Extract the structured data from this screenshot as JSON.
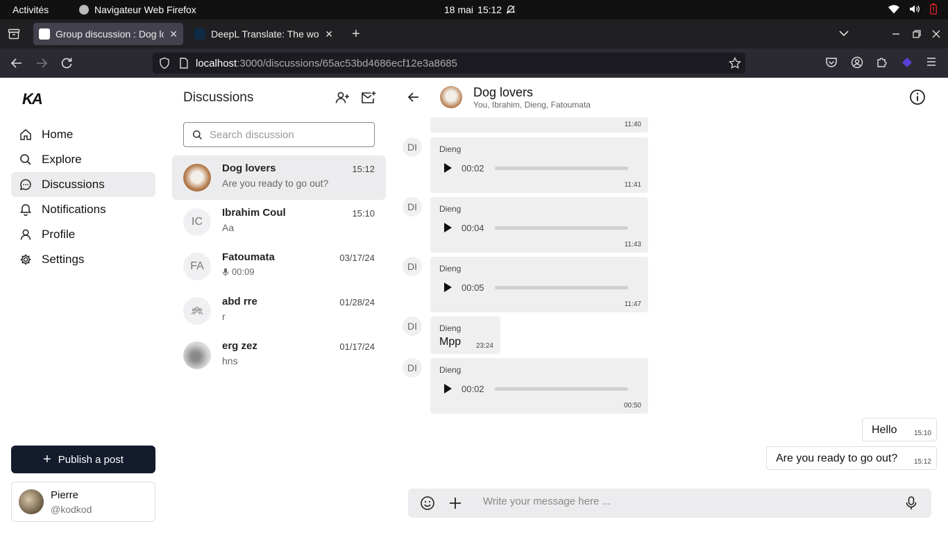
{
  "system_bar": {
    "activities": "Activités",
    "app_name": "Navigateur Web Firefox",
    "date": "18 mai",
    "time": "15:12"
  },
  "browser": {
    "tabs": [
      {
        "title": "Group discussion : Dog lo",
        "active": true
      },
      {
        "title": "DeepL Translate: The wo",
        "active": false
      }
    ],
    "url_host": "localhost",
    "url_path": ":3000/discussions/65ac53bd4686ecf12e3a8685"
  },
  "sidebar": {
    "logo": "KA",
    "items": [
      {
        "label": "Home",
        "icon": "home-icon"
      },
      {
        "label": "Explore",
        "icon": "search-icon"
      },
      {
        "label": "Discussions",
        "icon": "chat-icon",
        "active": true
      },
      {
        "label": "Notifications",
        "icon": "bell-icon"
      },
      {
        "label": "Profile",
        "icon": "user-icon"
      },
      {
        "label": "Settings",
        "icon": "gear-icon"
      }
    ],
    "publish_label": "Publish a post",
    "user": {
      "name": "Pierre",
      "handle": "@kodkod"
    }
  },
  "discussions": {
    "title": "Discussions",
    "search_placeholder": "Search discussion",
    "items": [
      {
        "name": "Dog lovers",
        "preview": "Are you ready to go out?",
        "time": "15:12",
        "avatar": "",
        "active": true
      },
      {
        "name": "Ibrahim Coul",
        "preview": "Aa",
        "time": "15:10",
        "avatar": "IC"
      },
      {
        "name": "Fatoumata",
        "preview": "00:09",
        "time": "03/17/24",
        "avatar": "FA"
      },
      {
        "name": "abd rre",
        "preview": "r",
        "time": "01/28/24",
        "avatar": ""
      },
      {
        "name": "erg zez",
        "preview": "hns",
        "time": "01/17/24",
        "avatar": ""
      }
    ]
  },
  "chat": {
    "name": "Dog lovers",
    "members": "You, Ibrahim, Dieng, Fatoumata",
    "messages": [
      {
        "initials": "DI",
        "sender": "Dieng",
        "type": "audio",
        "duration": "00:02",
        "time": "11:41"
      },
      {
        "initials": "DI",
        "sender": "Dieng",
        "type": "audio",
        "duration": "00:04",
        "time": "11:43"
      },
      {
        "initials": "DI",
        "sender": "Dieng",
        "type": "audio",
        "duration": "00:05",
        "time": "11:47"
      },
      {
        "initials": "DI",
        "sender": "Dieng",
        "type": "text",
        "text": "Mpp",
        "time": "23:24"
      },
      {
        "initials": "DI",
        "sender": "Dieng",
        "type": "audio",
        "duration": "00:02",
        "time": "00:50"
      }
    ],
    "partial_time": "11:40",
    "outgoing": [
      {
        "text": "Hello",
        "time": "15:10"
      },
      {
        "text": "Are you ready to go out?",
        "time": "15:12"
      }
    ],
    "composer_placeholder": "Write your message here ..."
  }
}
